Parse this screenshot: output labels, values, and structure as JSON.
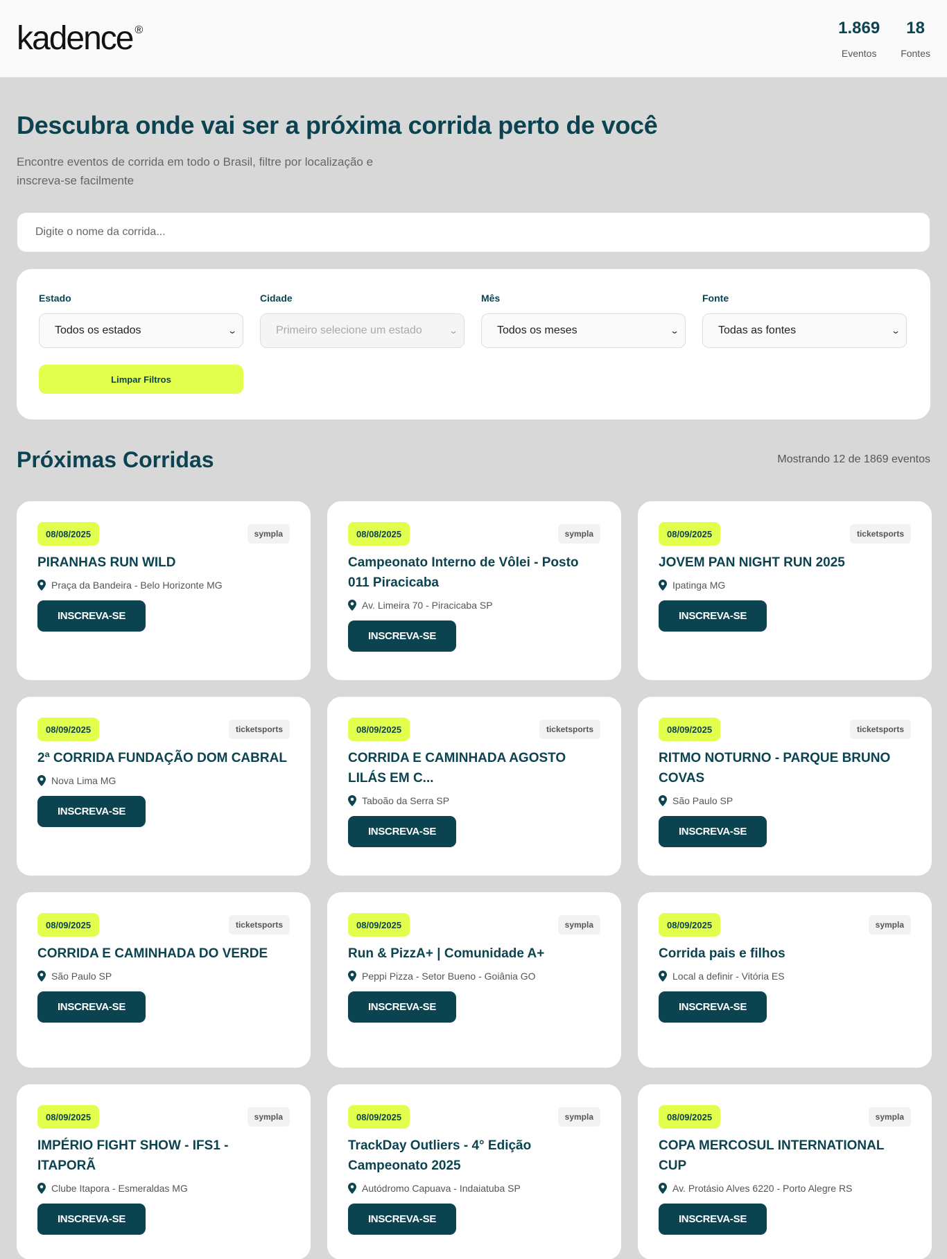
{
  "header": {
    "logo": "kadence",
    "logo_mark": "®",
    "stats": [
      {
        "value": "1.869",
        "label": "Eventos"
      },
      {
        "value": "18",
        "label": "Fontes"
      }
    ]
  },
  "hero": {
    "title": "Descubra onde vai ser a próxima corrida perto de você",
    "subtitle": "Encontre eventos de corrida em todo o Brasil, filtre por localização e inscreva-se facilmente"
  },
  "search": {
    "placeholder": "Digite o nome da corrida..."
  },
  "filters": {
    "items": [
      {
        "label": "Estado",
        "value": "Todos os estados"
      },
      {
        "label": "Cidade",
        "value": "Primeiro selecione um estado"
      },
      {
        "label": "Mês",
        "value": "Todos os meses"
      },
      {
        "label": "Fonte",
        "value": "Todas as fontes"
      }
    ],
    "clear_label": "Limpar Filtros"
  },
  "section": {
    "title": "Próximas Corridas",
    "showing": "Mostrando 12 de 1869 eventos"
  },
  "signup_label": "INSCREVA-SE",
  "events": [
    {
      "date": "08/08/2025",
      "source": "sympla",
      "title": "PIRANHAS RUN WILD",
      "location": "Praça da Bandeira - Belo Horizonte MG"
    },
    {
      "date": "08/08/2025",
      "source": "sympla",
      "title": "Campeonato Interno de Vôlei - Posto 011 Piracicaba",
      "location": "Av. Limeira 70 - Piracicaba SP"
    },
    {
      "date": "08/09/2025",
      "source": "ticketsports",
      "title": "JOVEM PAN NIGHT RUN 2025",
      "location": "Ipatinga MG"
    },
    {
      "date": "08/09/2025",
      "source": "ticketsports",
      "title": "2ª CORRIDA FUNDAÇÃO DOM CABRAL",
      "location": "Nova Lima MG"
    },
    {
      "date": "08/09/2025",
      "source": "ticketsports",
      "title": "CORRIDA E CAMINHADA AGOSTO LILÁS EM C...",
      "location": "Taboão da Serra SP"
    },
    {
      "date": "08/09/2025",
      "source": "ticketsports",
      "title": "RITMO NOTURNO - PARQUE BRUNO COVAS",
      "location": "São Paulo SP"
    },
    {
      "date": "08/09/2025",
      "source": "ticketsports",
      "title": "CORRIDA E CAMINHADA DO VERDE",
      "location": "São Paulo SP"
    },
    {
      "date": "08/09/2025",
      "source": "sympla",
      "title": "Run & PizzA+ | Comunidade A+",
      "location": "Peppi Pizza - Setor Bueno - Goiânia GO"
    },
    {
      "date": "08/09/2025",
      "source": "sympla",
      "title": "Corrida pais e filhos",
      "location": "Local a definir - Vitória ES"
    },
    {
      "date": "08/09/2025",
      "source": "sympla",
      "title": "IMPÉRIO FIGHT SHOW - IFS1 - ITAPORÃ",
      "location": "Clube Itapora - Esmeraldas MG"
    },
    {
      "date": "08/09/2025",
      "source": "sympla",
      "title": "TrackDay Outliers - 4° Edição Campeonato 2025",
      "location": "Autódromo Capuava - Indaiatuba SP"
    },
    {
      "date": "08/09/2025",
      "source": "sympla",
      "title": "COPA MERCOSUL INTERNATIONAL CUP",
      "location": "Av. Protásio Alves 6220 - Porto Alegre RS"
    }
  ]
}
